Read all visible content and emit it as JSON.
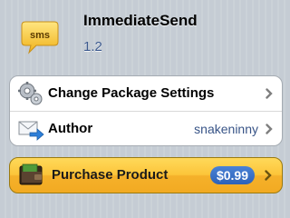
{
  "header": {
    "app_name": "ImmediateSend",
    "version": "1.2",
    "icon_text": "sms"
  },
  "settings_group": {
    "rows": [
      {
        "label": "Change Package Settings",
        "value": "",
        "icon": "gears-icon"
      },
      {
        "label": "Author",
        "value": "snakeninny",
        "icon": "mail-arrow-icon"
      }
    ]
  },
  "purchase": {
    "label": "Purchase Product",
    "price": "$0.99",
    "icon": "wallet-icon"
  },
  "colors": {
    "background": "#c5ccd4",
    "link_blue": "#385487",
    "purchase_gold": "#fcc53a",
    "price_badge": "#2d62b8"
  }
}
